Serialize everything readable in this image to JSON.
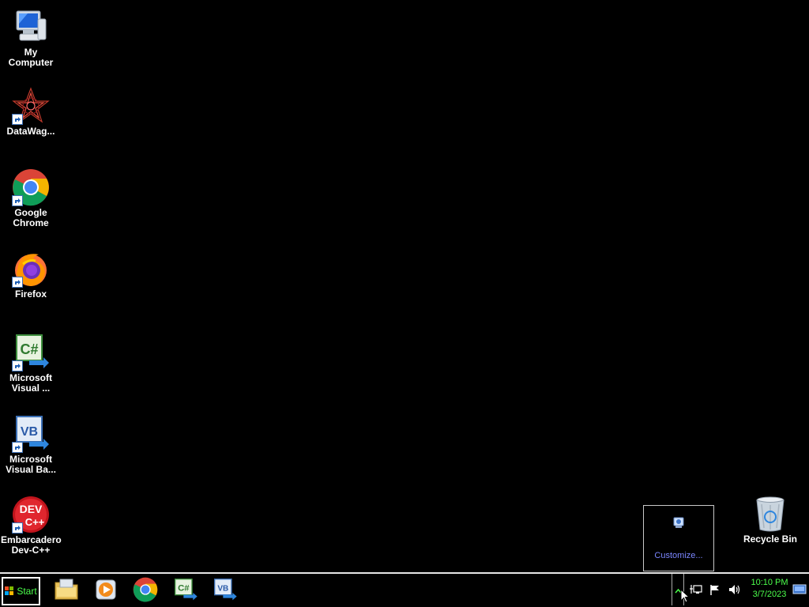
{
  "desktop": {
    "icons": [
      {
        "label": "My Computer",
        "icon": "computer-icon"
      },
      {
        "label": "DataWag...",
        "icon": "datawag-icon"
      },
      {
        "label": "Google\nChrome",
        "icon": "chrome-icon"
      },
      {
        "label": "Firefox",
        "icon": "firefox-icon"
      },
      {
        "label": "Microsoft\nVisual ...",
        "icon": "visual-csharp-icon"
      },
      {
        "label": "Microsoft\nVisual Ba...",
        "icon": "visual-basic-icon"
      },
      {
        "label": "Embarcadero\nDev-C++",
        "icon": "devcpp-icon"
      },
      {
        "label": "Recycle Bin",
        "icon": "recycle-bin-icon"
      }
    ]
  },
  "tray_popup": {
    "customize_label": "Customize..."
  },
  "taskbar": {
    "start_label": "Start",
    "pinned": [
      "folder-icon",
      "media-player-icon",
      "chrome-icon",
      "visual-csharp-icon",
      "visual-basic-icon"
    ],
    "clock": {
      "time": "10:10 PM",
      "date": "3/7/2023"
    }
  },
  "colors": {
    "desktop_bg": "#000000",
    "taskbar_text": "#4cff4c",
    "customize_link": "#7b86ff"
  }
}
